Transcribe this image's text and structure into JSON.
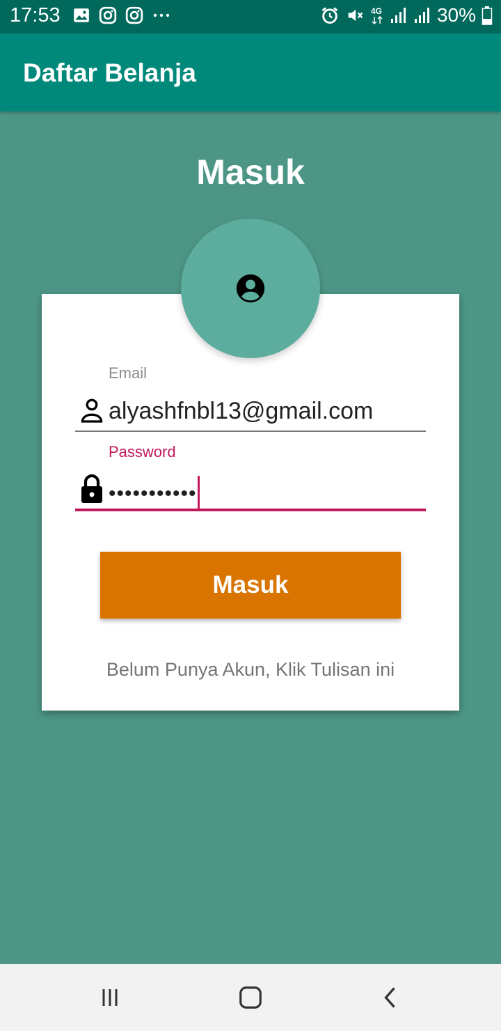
{
  "status_bar": {
    "time": "17:53",
    "battery": "30%",
    "network": "4G",
    "left_icons": [
      "gallery-icon",
      "instagram-icon",
      "instagram-icon",
      "more-dots-icon"
    ],
    "right_icons": [
      "alarm-icon",
      "mute-icon",
      "4g-icon",
      "signal-icon",
      "signal-icon",
      "battery-icon"
    ]
  },
  "app_bar": {
    "title": "Daftar Belanja"
  },
  "page": {
    "title": "Masuk"
  },
  "form": {
    "avatar_icon": "account-circle-icon",
    "email_label": "Email",
    "email_icon": "person-icon",
    "email_value": "alyashfnbl13@gmail.com",
    "password_label": "Password",
    "password_icon": "lock-icon",
    "password_value": "•••••••••••",
    "submit_label": "Masuk",
    "register_link": "Belum Punya Akun, Klik Tulisan ini"
  },
  "nav_bar": {
    "buttons": [
      "recents-icon",
      "home-icon",
      "back-icon"
    ]
  },
  "colors": {
    "status_bar": "#00695c",
    "app_bar": "#00897b",
    "background": "#4d9686",
    "avatar": "#5cad9d",
    "accent": "#c2185b",
    "button": "#d97400"
  }
}
